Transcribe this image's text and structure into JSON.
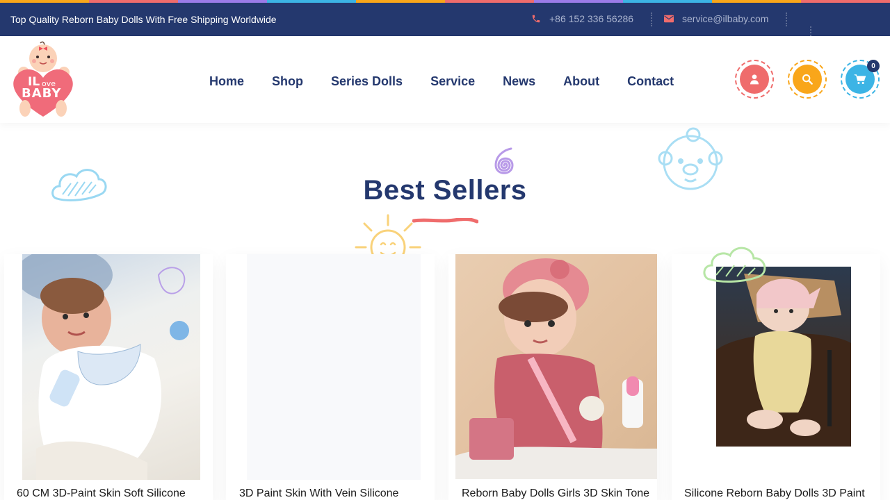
{
  "topbar": {
    "tagline": "Top Quality Reborn Baby Dolls With Free Shipping Worldwide",
    "phone": "+86 152 336 56286",
    "email": "service@ilbaby.com",
    "stripe_colors": [
      "#f9a61a",
      "#ef6c6c",
      "#9b7be8",
      "#3cb4e5",
      "#f9a61a",
      "#ef6c6c",
      "#9b7be8",
      "#3cb4e5",
      "#f9a61a",
      "#ef6c6c"
    ]
  },
  "logo": {
    "line1": "IL",
    "line2": "ove",
    "line3": "BABY"
  },
  "nav": {
    "items": [
      "Home",
      "Shop",
      "Series Dolls",
      "Service",
      "News",
      "About",
      "Contact"
    ]
  },
  "header_actions": {
    "account_icon": "user-icon",
    "search_icon": "search-icon",
    "cart_icon": "cart-icon",
    "cart_count": "0",
    "colors": {
      "account": "#ef6c6c",
      "search": "#f9a61a",
      "cart": "#3cb4e5"
    }
  },
  "best_sellers": {
    "title": "Best Sellers",
    "products": [
      {
        "title": "60 CM 3D-Paint Skin Soft Silicone"
      },
      {
        "title": "3D Paint Skin With Vein Silicone"
      },
      {
        "title": "Reborn Baby Dolls Girls 3D Skin Tone"
      },
      {
        "title": "Silicone Reborn Baby Dolls 3D Paint"
      }
    ]
  },
  "colors": {
    "navy": "#24386e",
    "accent_red": "#ef6c6c"
  }
}
